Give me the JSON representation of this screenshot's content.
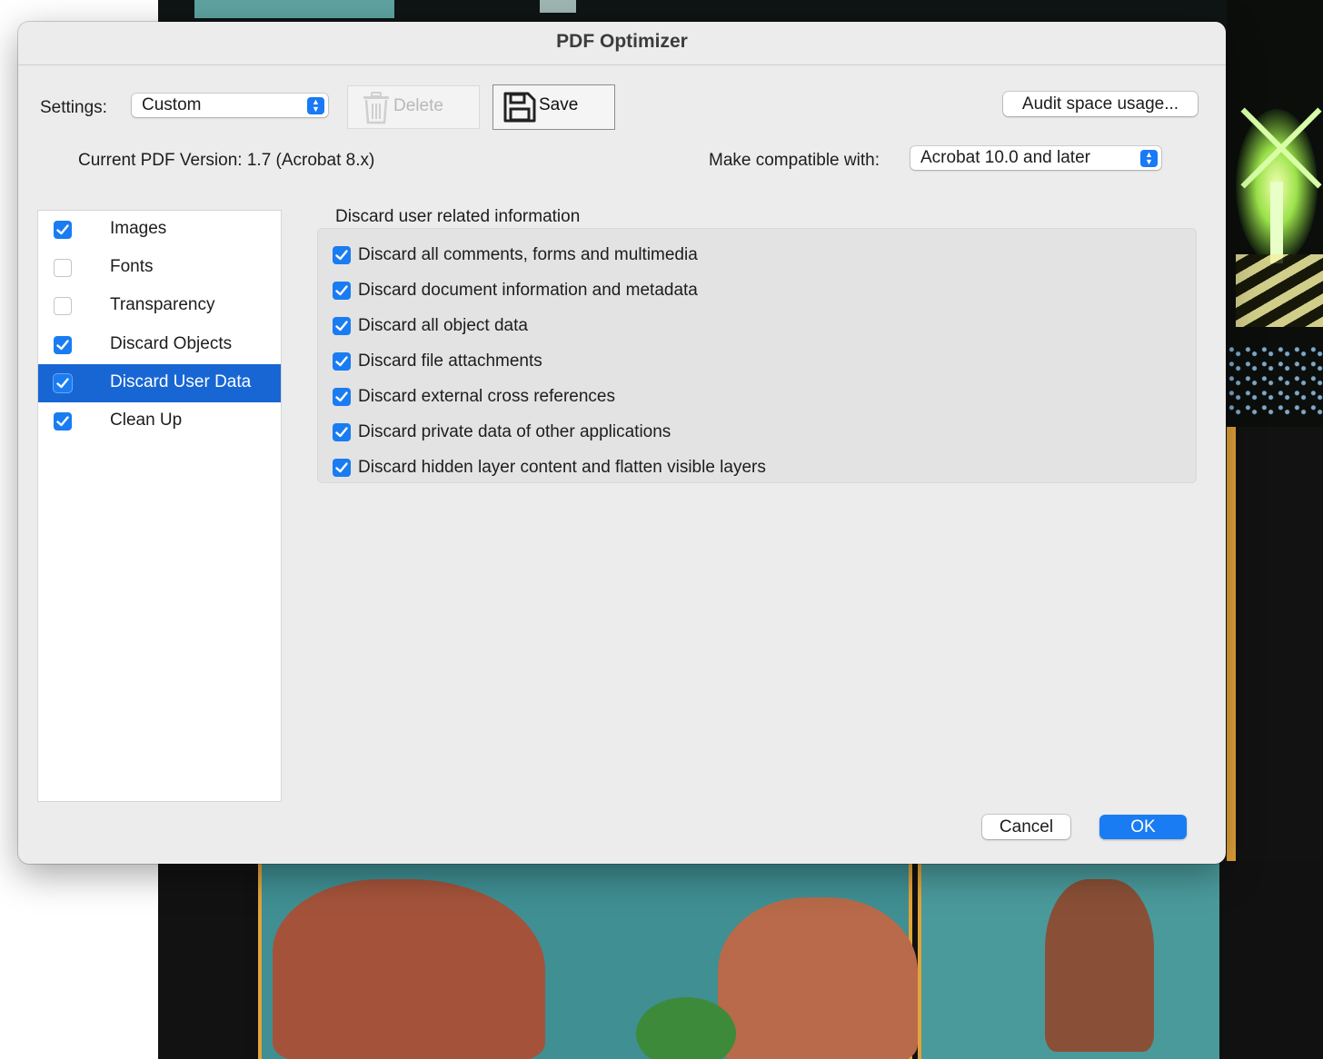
{
  "dialog": {
    "title": "PDF Optimizer"
  },
  "settings": {
    "label": "Settings:",
    "preset": "Custom",
    "delete_label": "Delete",
    "save_label": "Save",
    "audit_label": "Audit space usage...",
    "current_version": "Current PDF Version: 1.7 (Acrobat 8.x)",
    "compat_label": "Make compatible with:",
    "compat_value": "Acrobat 10.0 and later"
  },
  "categories": [
    {
      "label": "Images",
      "checked": true,
      "selected": false
    },
    {
      "label": "Fonts",
      "checked": false,
      "selected": false
    },
    {
      "label": "Transparency",
      "checked": false,
      "selected": false
    },
    {
      "label": "Discard Objects",
      "checked": true,
      "selected": false
    },
    {
      "label": "Discard User Data",
      "checked": true,
      "selected": true
    },
    {
      "label": "Clean Up",
      "checked": true,
      "selected": false
    }
  ],
  "panel": {
    "title": "Discard user related information",
    "options": [
      {
        "label": "Discard all comments, forms and multimedia",
        "checked": true
      },
      {
        "label": "Discard document information and metadata",
        "checked": true
      },
      {
        "label": "Discard all object data",
        "checked": true
      },
      {
        "label": "Discard file attachments",
        "checked": true
      },
      {
        "label": "Discard external cross references",
        "checked": true
      },
      {
        "label": "Discard private data of other applications",
        "checked": true
      },
      {
        "label": "Discard hidden layer content and flatten visible layers",
        "checked": true
      }
    ]
  },
  "footer": {
    "cancel_label": "Cancel",
    "ok_label": "OK"
  },
  "colors": {
    "accent": "#1a7cf2",
    "selection": "#1866d4",
    "dialog_bg": "#ececec"
  },
  "icons": {
    "delete": "trash-icon",
    "save": "floppy-disk-icon",
    "popup": "chevron-up-down-icon",
    "checkbox": "checkmark-icon"
  }
}
